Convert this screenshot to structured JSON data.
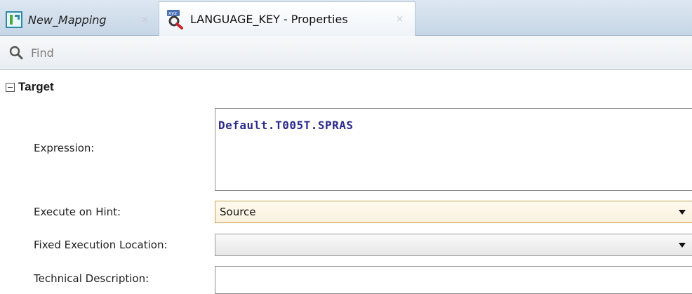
{
  "tabs": [
    {
      "label": "New_Mapping",
      "icon": "mapping-icon",
      "close": "×",
      "active": false
    },
    {
      "label": "LANGUAGE_KEY - Properties",
      "icon": "properties-icon",
      "close": "×",
      "active": true
    }
  ],
  "find": {
    "label": "Find",
    "icon": "search-icon"
  },
  "section": {
    "title": "Target",
    "collapsed": false
  },
  "properties": {
    "expression": {
      "label": "Expression:",
      "value": "Default.T005T.SPRAS"
    },
    "execute_on_hint": {
      "label": "Execute on Hint:",
      "value": "Source"
    },
    "fixed_execution_location": {
      "label": "Fixed Execution Location:",
      "value": ""
    },
    "technical_description": {
      "label": "Technical Description:",
      "value": ""
    }
  },
  "colors": {
    "expression_text": "#2c2c8c",
    "hint_combo_border": "#c9a14a",
    "tabbar_bg": "#c6d6e6"
  }
}
